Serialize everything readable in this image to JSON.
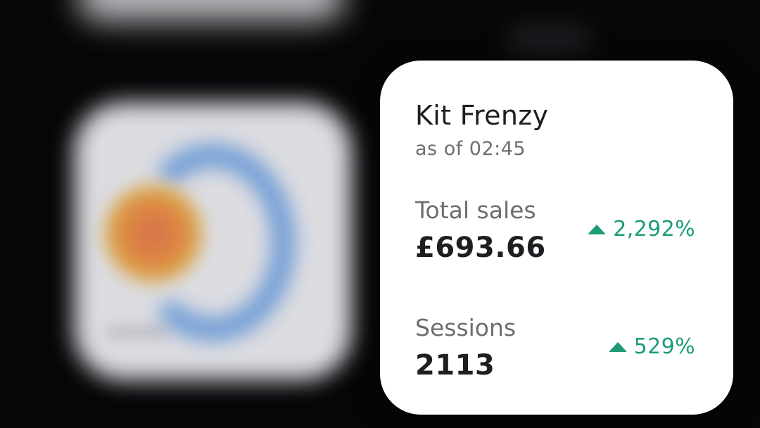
{
  "widget": {
    "store_name": "Kit Frenzy",
    "as_of": "as of 02:45",
    "accent_color": "#1f9b7a",
    "metrics": [
      {
        "label": "Total sales",
        "value": "£693.66",
        "change": "2,292%",
        "trend_icon": "triangle-up-icon"
      },
      {
        "label": "Sessions",
        "value": "2113",
        "change": "529%",
        "trend_icon": "triangle-up-icon"
      }
    ]
  }
}
